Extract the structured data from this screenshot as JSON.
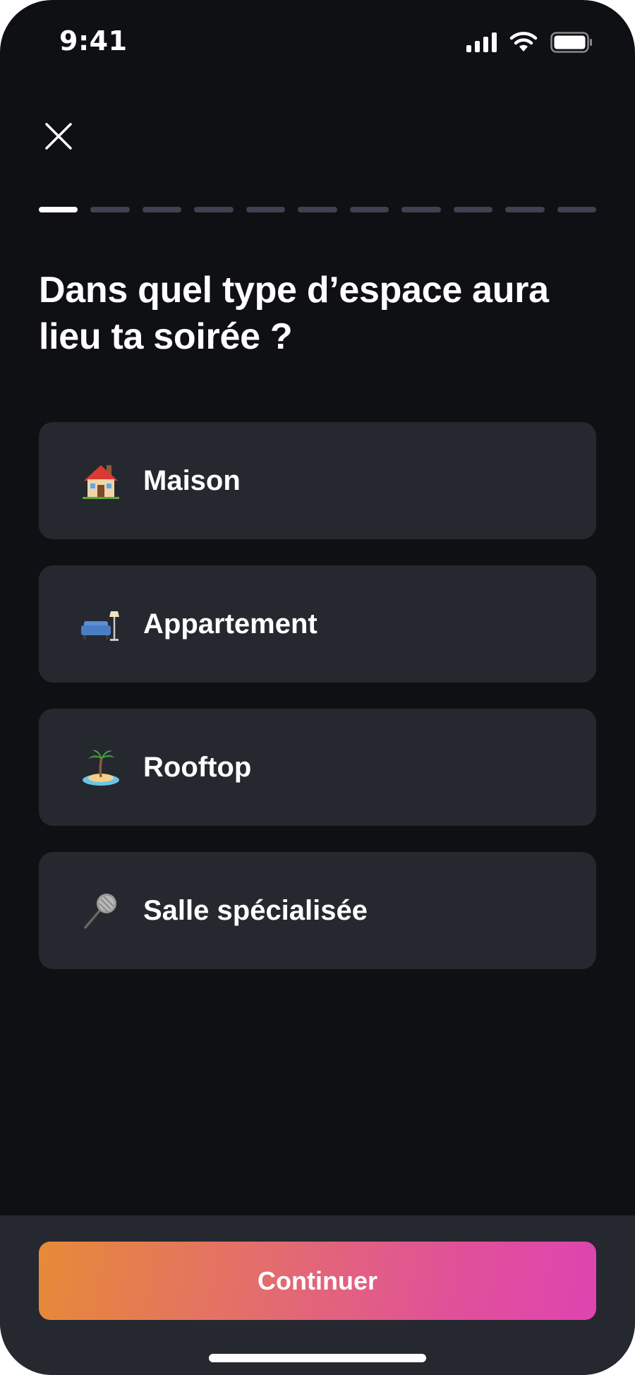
{
  "status_bar": {
    "time": "9:41",
    "icons": [
      "signal-icon",
      "wifi-icon",
      "battery-icon"
    ]
  },
  "header": {
    "close_icon": "close-icon"
  },
  "progress": {
    "total_steps": 11,
    "current_step": 1
  },
  "question": {
    "title": "Dans quel type d’espace aura lieu ta soirée ?"
  },
  "options": [
    {
      "label": "Maison",
      "icon": "house-icon"
    },
    {
      "label": "Appartement",
      "icon": "couch-lamp-icon"
    },
    {
      "label": "Rooftop",
      "icon": "island-icon"
    },
    {
      "label": "Salle spécialisée",
      "icon": "microphone-icon"
    }
  ],
  "footer": {
    "continue_label": "Continuer"
  },
  "colors": {
    "background": "#0f1013",
    "card": "#262830",
    "progress_inactive": "#3f4250",
    "gradient_start": "#e68a37",
    "gradient_end": "#df44b0"
  }
}
